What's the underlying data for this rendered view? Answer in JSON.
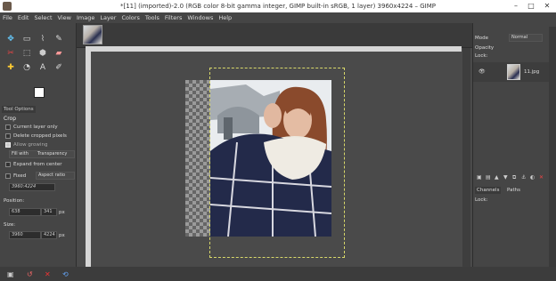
{
  "window": {
    "title": "*[11] (imported)-2.0 (RGB color 8-bit gamma integer, GIMP built-in sRGB, 1 layer) 3960x4224 – GIMP",
    "minimize": "–",
    "maximize": "□",
    "close": "✕"
  },
  "menu": [
    "File",
    "Edit",
    "Select",
    "View",
    "Image",
    "Layer",
    "Colors",
    "Tools",
    "Filters",
    "Windows",
    "Help"
  ],
  "tool_options": {
    "tab_label": "Tool Options",
    "tool_name": "Crop",
    "current_layer_only": "Current layer only",
    "delete_cropped": "Delete cropped pixels",
    "allow_growing": "Allow growing",
    "fill_with_label": "Fill with",
    "fill_with_value": "Transparency",
    "expand_from_center": "Expand from center",
    "fixed_label": "Fixed",
    "fixed_value": "Aspect ratio",
    "ratio": "3960:4224",
    "position_label": "Position:",
    "position_unit": "px",
    "position_x": "638",
    "position_y": "341",
    "size_label": "Size:",
    "size_unit": "px",
    "size_w": "3960",
    "size_h": "4224"
  },
  "dock": {
    "mode_label": "Mode",
    "mode_value": "Normal",
    "opacity_label": "Opacity",
    "lock_label": "Lock:",
    "layer_name": "11.jpg",
    "tabs": [
      "Channels",
      "Paths"
    ],
    "lock_label_2": "Lock:"
  },
  "icons": [
    "move-icon",
    "rect-select-icon",
    "lasso-icon",
    "fuzzy-select-icon",
    "crop-icon",
    "transform-icon",
    "paint-icon",
    "eraser-icon",
    "heal-icon",
    "smudge-icon",
    "text-icon",
    "color-picker-icon"
  ],
  "colors": {
    "selection": "#d8d86a",
    "foreground": "#ffffff",
    "background": "#000000"
  }
}
